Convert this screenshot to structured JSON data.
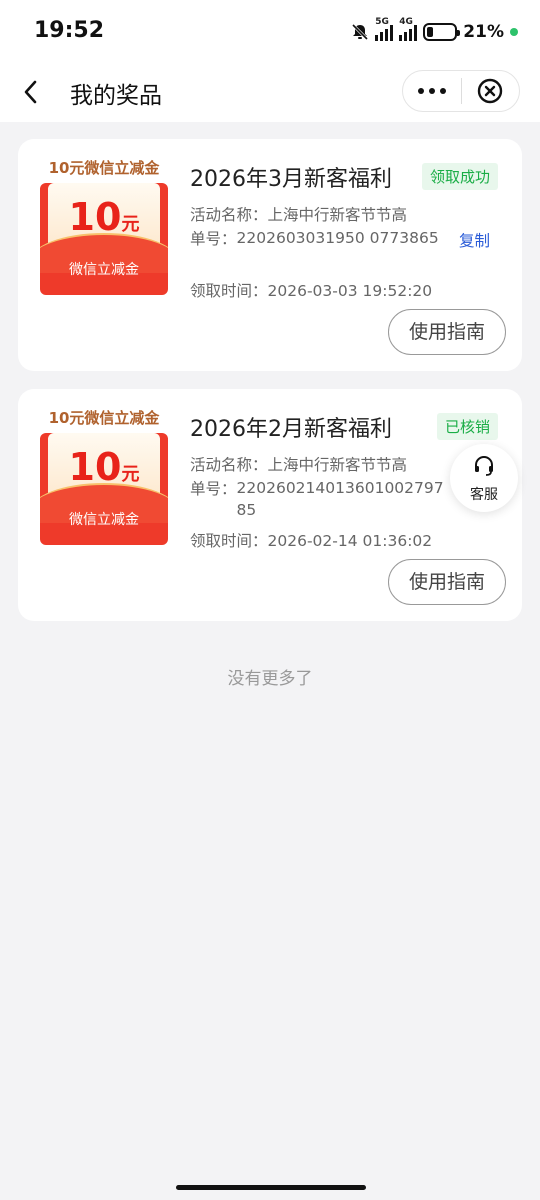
{
  "status_bar": {
    "time": "19:52",
    "network_1": "5G",
    "network_2": "4G",
    "battery_percent": "21%",
    "battery_level": 0.21
  },
  "nav": {
    "title": "我的奖品"
  },
  "prizes": [
    {
      "coupon_top_label": "10元微信立减金",
      "coupon_amount": "10",
      "coupon_unit": "元",
      "coupon_bottom_label": "微信立减金",
      "title": "2026年3月新客福利",
      "status": "领取成功",
      "activity_label": "活动名称：",
      "activity_name": "上海中行新客节节高",
      "order_label": "单号：",
      "order_no": "2202603031950  0773865",
      "copy_label": "复制",
      "time_label": "领取时间：",
      "time": "2026-03-03 19:52:20",
      "guide_label": "使用指南"
    },
    {
      "coupon_top_label": "10元微信立减金",
      "coupon_amount": "10",
      "coupon_unit": "元",
      "coupon_bottom_label": "微信立减金",
      "title": "2026年2月新客福利",
      "status": "已核销",
      "activity_label": "活动名称：",
      "activity_name": "上海中行新客节节高",
      "order_label": "单号：",
      "order_no": "22026021401360100279785",
      "time_label": "领取时间：",
      "time": "2026-02-14 01:36:02",
      "guide_label": "使用指南"
    }
  ],
  "customer_service": {
    "label": "客服"
  },
  "footer": {
    "no_more": "没有更多了"
  },
  "colors": {
    "accent_green": "#1aad46",
    "coupon_red": "#ee3a2a",
    "link_blue": "#2a5bd7"
  }
}
